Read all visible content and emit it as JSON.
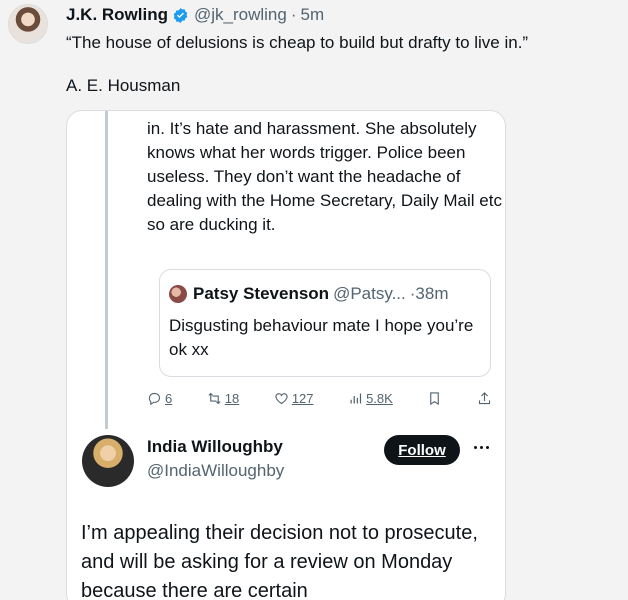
{
  "tweet": {
    "author": "J.K. Rowling",
    "handle": "@jk_rowling",
    "separator": "·",
    "time": "5m",
    "quote": "“The house of delusions is cheap to build but drafty to live in.”",
    "attribution": "A. E. Housman"
  },
  "embedded": {
    "reply_text": "in. It’s hate and harassment. She absolutely knows what her words trigger. Police been useless. They don’t want the headache of dealing with the Home Secretary, Daily Mail etc so are ducking it.",
    "inner_quote": {
      "name": "Patsy Stevenson",
      "handle": "@Patsy...",
      "time": "·38m",
      "text": "Disgusting behaviour mate I hope you’re ok xx"
    },
    "actions": {
      "replies": "6",
      "retweets": "18",
      "likes": "127",
      "views": "5.8K"
    },
    "user": {
      "name": "India Willoughby",
      "handle": "@IndiaWilloughby",
      "follow_label": "Follow"
    },
    "body_text": "I’m appealing their decision not to prosecute, and will be asking for a review on Monday because there are certain"
  },
  "colors": {
    "accent": "#1d9bf0",
    "text": "#0f1419",
    "muted": "#536471"
  }
}
